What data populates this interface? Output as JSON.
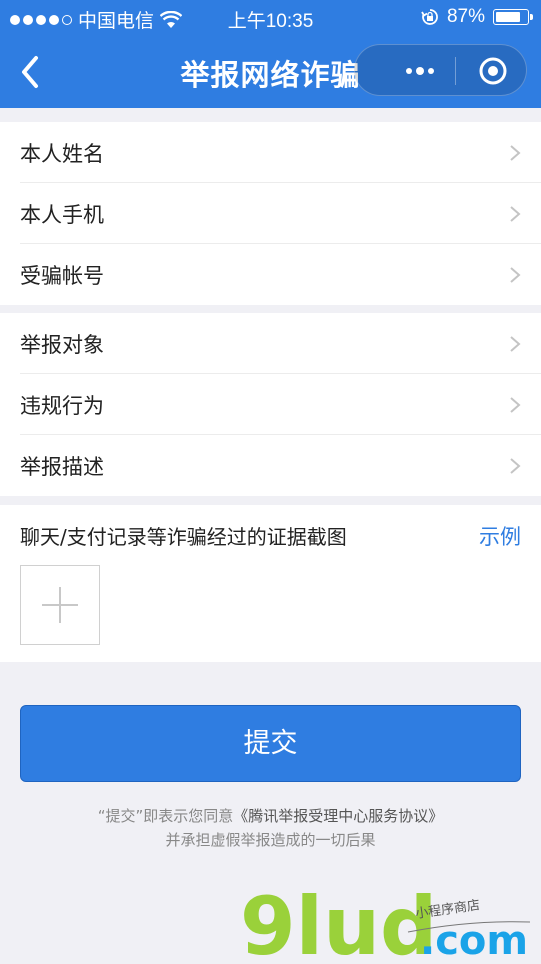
{
  "status_bar": {
    "carrier": "中国电信",
    "time": "上午10:35",
    "battery": "87%",
    "battery_level": 0.87
  },
  "nav": {
    "title": "举报网络诈骗",
    "back_icon": "chevron-left-icon",
    "more_icon": "more-dots-icon",
    "close_icon": "miniprogram-close-icon"
  },
  "personal": {
    "items": [
      {
        "label": "本人姓名"
      },
      {
        "label": "本人手机"
      },
      {
        "label": "受骗帐号"
      }
    ]
  },
  "report": {
    "items": [
      {
        "label": "举报对象"
      },
      {
        "label": "违规行为"
      },
      {
        "label": "举报描述"
      }
    ]
  },
  "evidence": {
    "title": "聊天/支付记录等诈骗经过的证据截图",
    "example_link": "示例",
    "upload_icon": "plus-icon"
  },
  "submit": {
    "label": "提交"
  },
  "agreement": {
    "prefix": "“提交”即表示您同意",
    "link": "《腾讯举报受理中心服务协议》",
    "line2": "并承担虚假举报造成的一切后果"
  },
  "watermark": {
    "brand": "9lud",
    "tld": ".com",
    "tagline": "小程序商店"
  },
  "colors": {
    "primary": "#2f7de1",
    "background": "#f0f0f5",
    "watermark_green": "#9ad13a",
    "watermark_blue": "#1aa3e8"
  }
}
